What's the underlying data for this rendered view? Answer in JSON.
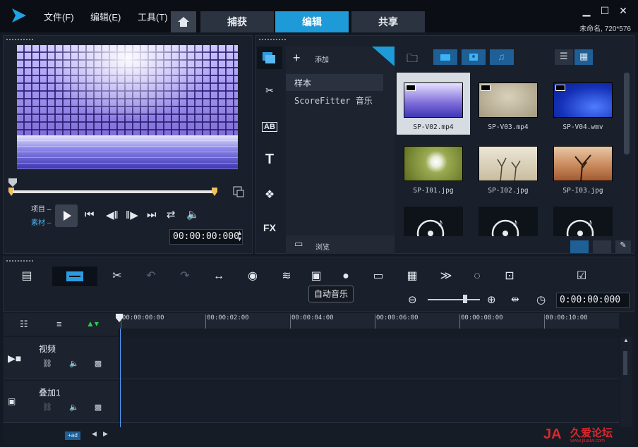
{
  "menu": {
    "file": "文件(F)",
    "edit": "编辑(E)",
    "tools": "工具(T)"
  },
  "tabs": [
    {
      "label": "捕获",
      "active": false
    },
    {
      "label": "编辑",
      "active": true
    },
    {
      "label": "共享",
      "active": false
    }
  ],
  "project_info": "未命名, 720*576",
  "player": {
    "project_label": "项目",
    "clip_label": "素材",
    "timecode": "00:00:00:000"
  },
  "library": {
    "add_label": "添加",
    "sections": [
      {
        "label": "样本",
        "selected": true
      },
      {
        "label": "ScoreFitter 音乐",
        "selected": false
      }
    ],
    "browse_label": "浏览",
    "side_icons": [
      "media-icon",
      "instant-project-icon",
      "transition-icon",
      "title-icon",
      "graphic-icon",
      "filter-icon"
    ],
    "fx_label": "FX",
    "title_letter": "T",
    "transition_label": "AB",
    "items": [
      {
        "name": "SP-V02.mp4",
        "kind": "video",
        "selected": true,
        "color": "#6c5fd6"
      },
      {
        "name": "SP-V03.mp4",
        "kind": "video",
        "selected": false,
        "color": "#b7ad94"
      },
      {
        "name": "SP-V04.wmv",
        "kind": "video",
        "selected": false,
        "color": "#1d3fc8"
      },
      {
        "name": "SP-I01.jpg",
        "kind": "image",
        "selected": false,
        "color": "#8a9a3c"
      },
      {
        "name": "SP-I02.jpg",
        "kind": "image",
        "selected": false,
        "color": "#d8cfb8"
      },
      {
        "name": "SP-I03.jpg",
        "kind": "image",
        "selected": false,
        "color": "#c08058"
      },
      {
        "name": "",
        "kind": "audio",
        "selected": false,
        "color": "#0e1219"
      },
      {
        "name": "",
        "kind": "audio",
        "selected": false,
        "color": "#0e1219"
      },
      {
        "name": "",
        "kind": "audio",
        "selected": false,
        "color": "#0e1219"
      }
    ]
  },
  "toolbar": {
    "tooltip": "自动音乐",
    "zoom_time": "0:00:00:000",
    "zoom_level": 0.72
  },
  "timeline": {
    "ticks": [
      "00:00:00:00",
      "00:00:02:00",
      "00:00:04:00",
      "00:00:06:00",
      "00:00:08:00",
      "00:00:10:00"
    ],
    "tracks": [
      {
        "label": "视频"
      },
      {
        "label": "叠加1"
      }
    ],
    "bottom_btn": "+ad"
  },
  "watermark": {
    "text": "久爱论坛",
    "url": "www.jiuaiw.com"
  },
  "colors": {
    "accent": "#1e9ad8",
    "scrub_yellow": "#f0c060",
    "playhead": "#5aa0ff"
  }
}
